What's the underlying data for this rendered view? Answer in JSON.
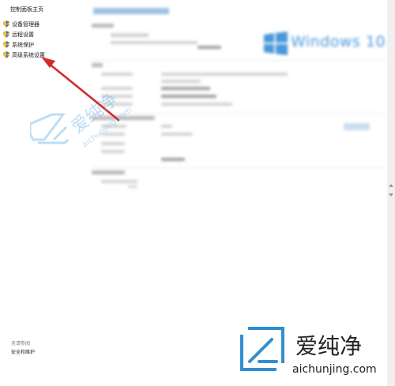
{
  "sidebar": {
    "home_link": "控制面板主页",
    "items": [
      {
        "label": "设备管理器",
        "icon": "shield-icon"
      },
      {
        "label": "远程设置",
        "icon": "shield-icon"
      },
      {
        "label": "系统保护",
        "icon": "shield-icon"
      },
      {
        "label": "高级系统设置",
        "icon": "shield-icon"
      }
    ],
    "see_also": "另请参阅",
    "security_link": "安全和维护"
  },
  "main": {
    "windows_logo_text": "Windows 10"
  },
  "watermark": {
    "brand": "爱纯净",
    "domain": "aichunjing.com"
  },
  "colors": {
    "annotation_arrow": "#d42a2a",
    "windows_blue": "#4a97d9",
    "shield_blue": "#3a6fb5",
    "shield_yellow": "#f2c12e",
    "watermark_blue": "#2f8fd0"
  }
}
